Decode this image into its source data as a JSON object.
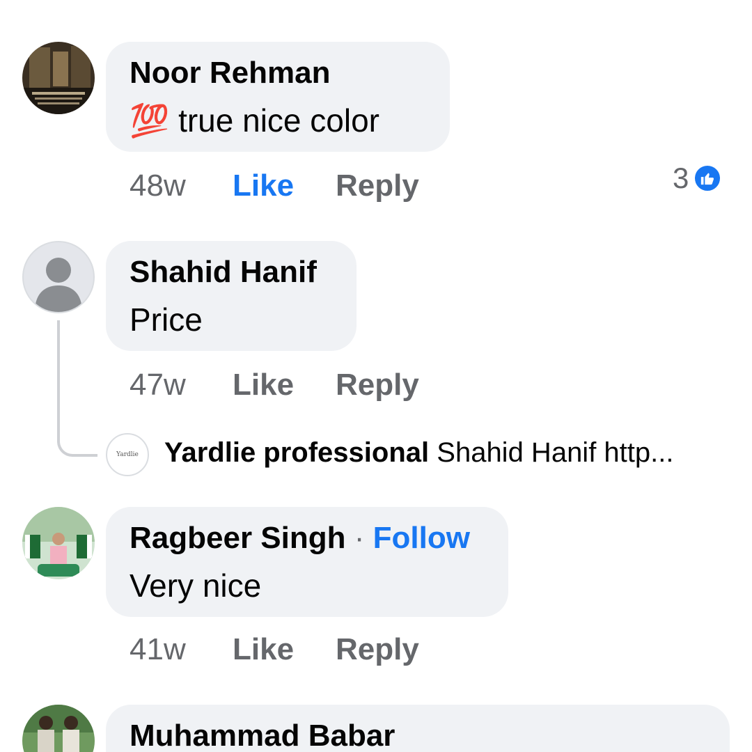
{
  "comments": [
    {
      "author": "Noor Rehman",
      "text": "true nice color",
      "emoji": "💯",
      "time": "48w",
      "like_label": "Like",
      "reply_label": "Reply",
      "reaction_count": "3"
    },
    {
      "author": "Shahid Hanif",
      "text": "Price",
      "time": "47w",
      "like_label": "Like",
      "reply_label": "Reply",
      "reply_preview": {
        "author": "Yardlie professional",
        "text": "Shahid Hanif http...",
        "avatar_text": "Yardlie"
      }
    },
    {
      "author": "Ragbeer Singh",
      "separator": "·",
      "follow_label": "Follow",
      "text": "Very nice",
      "time": "41w",
      "like_label": "Like",
      "reply_label": "Reply"
    },
    {
      "author": "Muhammad Babar"
    }
  ],
  "colors": {
    "accent": "#1877f2",
    "bubble": "#f0f2f5",
    "secondary_text": "#65676b"
  }
}
